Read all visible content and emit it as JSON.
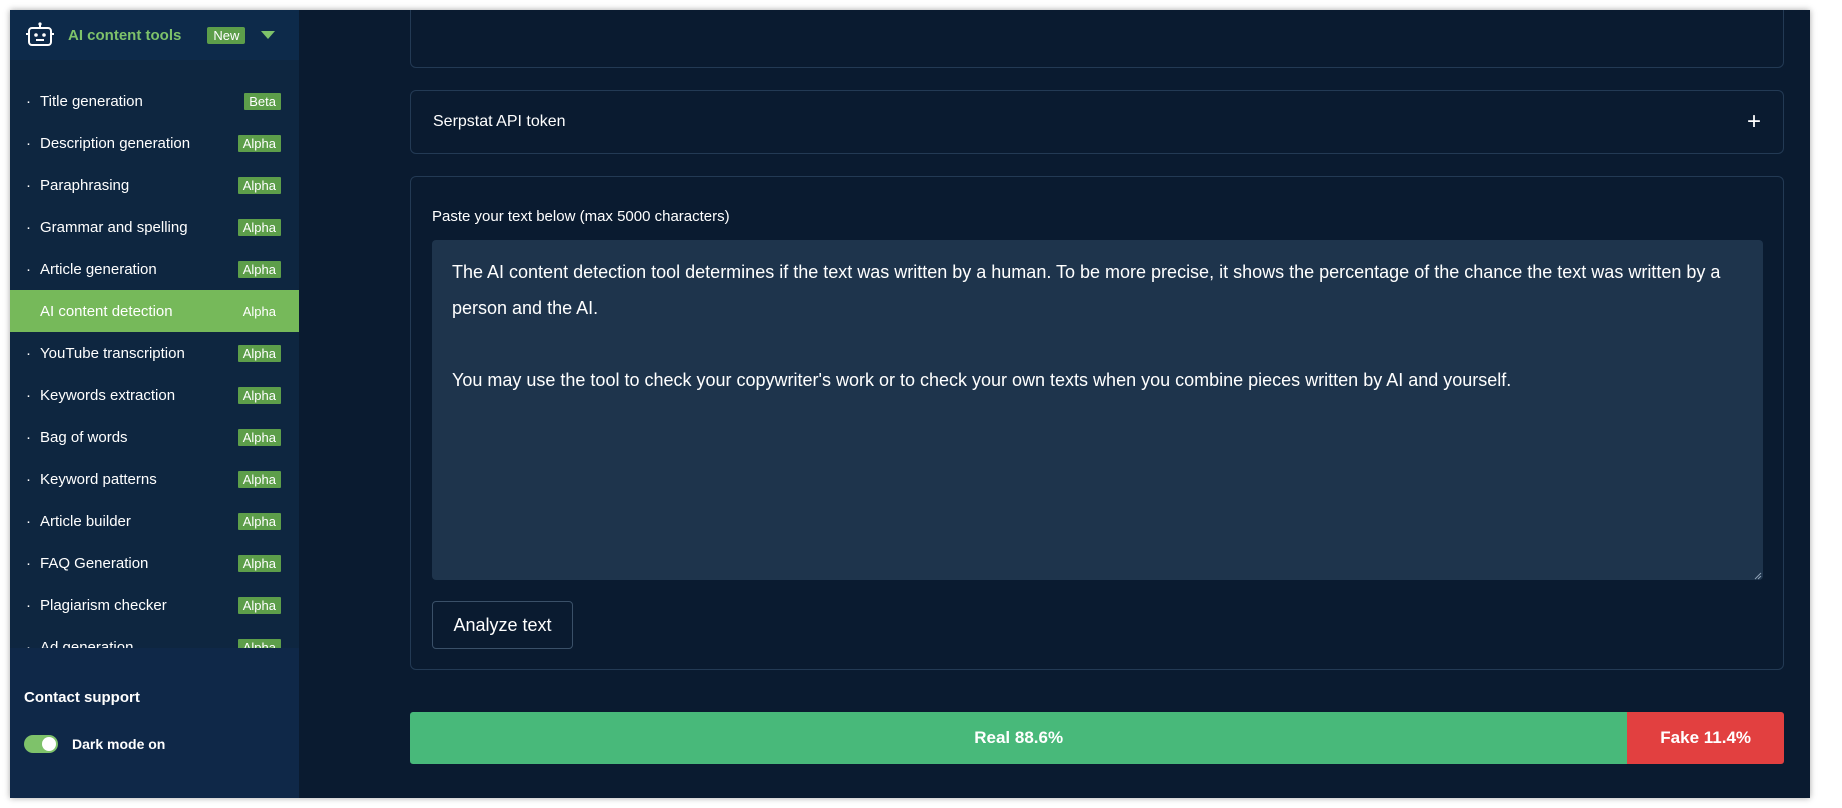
{
  "sidebar": {
    "header": {
      "title": "AI content tools",
      "badge": "New"
    },
    "items": [
      {
        "label": "Title generation",
        "tag": "Beta"
      },
      {
        "label": "Description generation",
        "tag": "Alpha"
      },
      {
        "label": "Paraphrasing",
        "tag": "Alpha"
      },
      {
        "label": "Grammar and spelling",
        "tag": "Alpha"
      },
      {
        "label": "Article generation",
        "tag": "Alpha"
      },
      {
        "label": "AI content detection",
        "tag": "Alpha"
      },
      {
        "label": "YouTube transcription",
        "tag": "Alpha"
      },
      {
        "label": "Keywords extraction",
        "tag": "Alpha"
      },
      {
        "label": "Bag of words",
        "tag": "Alpha"
      },
      {
        "label": "Keyword patterns",
        "tag": "Alpha"
      },
      {
        "label": "Article builder",
        "tag": "Alpha"
      },
      {
        "label": "FAQ Generation",
        "tag": "Alpha"
      },
      {
        "label": "Plagiarism checker",
        "tag": "Alpha"
      },
      {
        "label": "Ad generation",
        "tag": "Alpha"
      }
    ],
    "active_item": "AI content detection",
    "footer": {
      "contact": "Contact support",
      "dark_mode_label": "Dark mode on"
    }
  },
  "main": {
    "api_panel": {
      "title": "Serpstat API token"
    },
    "input_panel": {
      "label": "Paste your text below (max 5000 characters)",
      "text": "The AI content detection tool determines if the text was written by a human. To be more precise, it shows the percentage of the chance the text was written by a person and the AI.\n\nYou may use the tool to check your copywriter's work or to check your own texts when you combine pieces written by AI and yourself.",
      "analyze_label": "Analyze text"
    },
    "result": {
      "real_label": "Real 88.6%",
      "fake_label": "Fake 11.4%",
      "real_percent": 88.6,
      "fake_percent": 11.4
    }
  },
  "colors": {
    "background": "#0a1b30",
    "sidebar": "#0e2640",
    "accent_green": "#7ec26a",
    "active_item": "#76b95a",
    "real": "#48b97a",
    "fake": "#e24040"
  }
}
